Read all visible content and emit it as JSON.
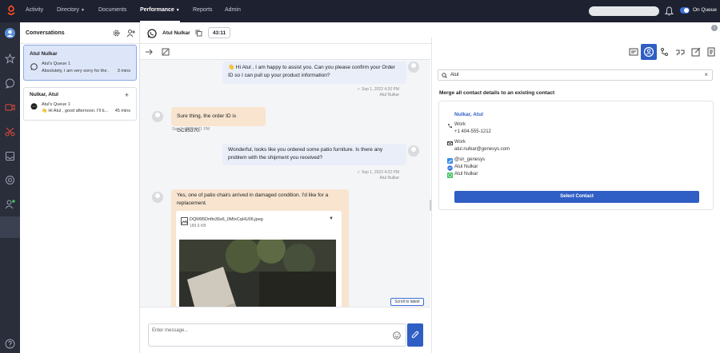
{
  "nav": {
    "items": [
      {
        "label": "Activity",
        "caret": false
      },
      {
        "label": "Directory",
        "caret": true
      },
      {
        "label": "Documents",
        "caret": false
      },
      {
        "label": "Performance",
        "caret": true
      },
      {
        "label": "Reports",
        "caret": false
      },
      {
        "label": "Admin",
        "caret": false
      }
    ],
    "active": "Performance",
    "caret_glyph": "▼",
    "status_label": "On Queue"
  },
  "conversations": {
    "title": "Conversations",
    "cards": [
      {
        "name": "Atul Nulkar",
        "queue": "Atul's Queue 1",
        "snippet": "Absolutely, I am very sorry for the ...",
        "time": "3 mins",
        "channel": "whatsapp"
      },
      {
        "name": "Nulkar, Atul",
        "queue": "Atul's Queue 1",
        "snippet": "👋 Hi Atul , good afternoon. I'll b...",
        "time": "45 mins",
        "channel": "messenger",
        "plus": "+"
      }
    ]
  },
  "chat": {
    "contact_name": "Atul Nulkar",
    "timer": "43:11",
    "messages": [
      {
        "direction": "out",
        "text": "👋 Hi Atul , I am happy to assist you. Can you please confirm your Order ID so I can pull up your product information?",
        "time": "Sep 1, 2022 4:20 PM",
        "author": "Atul Nulkar"
      },
      {
        "direction": "in",
        "text": "Sure thing, the order ID is GC95370.",
        "time": "Sep 1, 2022 4:21 PM"
      },
      {
        "direction": "out",
        "text": "Wonderful, looks like you ordered some patio furniture. Is there any problem with the shipment you received?",
        "time": "Sep 1, 2022 4:22 PM",
        "author": "Atul Nulkar"
      },
      {
        "direction": "in",
        "text": "Yes, one of patio chairs arrived in damaged condition. I'd like for a replacement."
      }
    ],
    "attachment": {
      "filename": "DQM95Dnfts36s6_0MtxCqHU06.jpeg",
      "size": "189.6 KB",
      "expand_glyph": "▼"
    },
    "scroll_latest": "Scroll to latest",
    "input_placeholder": "Enter message..."
  },
  "contact_panel": {
    "search_value": "Atul",
    "clear_glyph": "×",
    "merge_heading": "Merge all contact details to an existing contact",
    "contact": {
      "name": "Nulkar, Atul",
      "phone_label": "Work",
      "phone": "+1 404-555-1212",
      "email_label": "Work",
      "email": "atul.nulkar@genesys.com",
      "twitter": "@sn_genesys",
      "messenger": "Atul Nulkar",
      "whatsapp": "Atul Nulkar"
    },
    "select_button": "Select Contact"
  },
  "colors": {
    "accent": "#2f5ec4",
    "topbar": "#1e2130",
    "rail": "#2a2d3a",
    "inbound": "#f8e4cf",
    "outbound": "#e9eef9"
  }
}
